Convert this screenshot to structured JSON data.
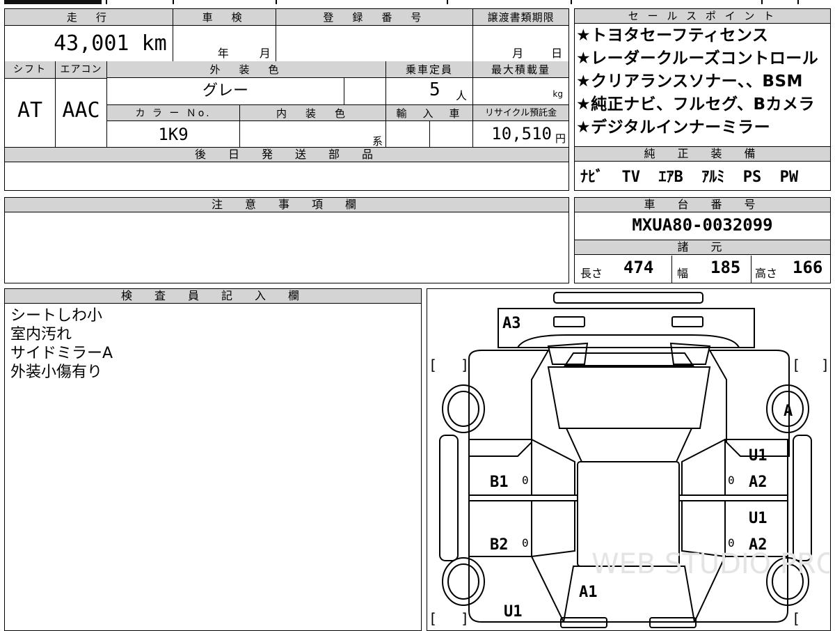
{
  "vehicle_info": {
    "mileage_label": "走　行",
    "mileage_value": "43,001",
    "mileage_unit": "km",
    "inspection_label": "車　検",
    "inspection_year": "年",
    "inspection_month": "月",
    "registration_label": "登　録　番　号",
    "registration_value": "",
    "transfer_label": "譲渡書類期限",
    "transfer_month": "月",
    "transfer_day": "日",
    "shift_label": "シフト",
    "shift_value": "AT",
    "ac_label": "エアコン",
    "ac_value": "AAC",
    "exterior_label": "外　装　色",
    "exterior_value": "グレー",
    "capacity_label": "乗車定員",
    "capacity_value": "5",
    "capacity_unit": "人",
    "load_label": "最大積載量",
    "load_unit": "kg",
    "color_no_label": "カ ラ ー Ｎo.",
    "color_no_value": "1K9",
    "interior_label": "内　装　色",
    "interior_unit": "系",
    "import_label": "輸　入　車",
    "recycle_label": "リサイクル預託金",
    "recycle_value": "10,510",
    "recycle_unit": "円",
    "later_parts_label": "後　日　発　送　部　品"
  },
  "sales_points": {
    "header": "セ ー ル ス ポ イ ン ト",
    "lines": [
      "★トヨタセーフティセンス",
      "★レーダークルーズコントロール",
      "★クリアランスソナー、、BSM",
      "★純正ナビ、フルセグ、Bカメラ",
      "★デジタルインナーミラー"
    ]
  },
  "equipment": {
    "header": "純　正　装　備",
    "value": "ﾅﾋﾞ  TV  ｴｱB  ｱﾙﾐ  PS  PW"
  },
  "notes": {
    "header": "注　意　事　項　欄",
    "value": ""
  },
  "chassis": {
    "header": "車　台　番　号",
    "value": "MXUA80-0032099"
  },
  "specs": {
    "header": "諸　元",
    "length_label": "長さ",
    "length_value": "474",
    "width_label": "幅",
    "width_value": "185",
    "height_label": "高さ",
    "height_value": "166"
  },
  "inspector": {
    "header": "検　査　員　記　入　欄",
    "lines": [
      "シートしわ小",
      "室内汚れ",
      "サイドミラーA",
      "外装小傷有り"
    ]
  },
  "diagram": {
    "marks": {
      "a3": "A3",
      "a_right": "A",
      "u1_right_top": "U1",
      "a2_right_top": "A2",
      "u1_right_bottom": "U1",
      "a2_right_bottom": "A2",
      "b1": "B1",
      "b2": "B2",
      "a1": "A1",
      "u1_bottom": "U1",
      "zero_1": "0",
      "zero_2": "0",
      "zero_3": "0",
      "zero_4": "0"
    },
    "watermark": "WEB STUDIO PRO"
  }
}
